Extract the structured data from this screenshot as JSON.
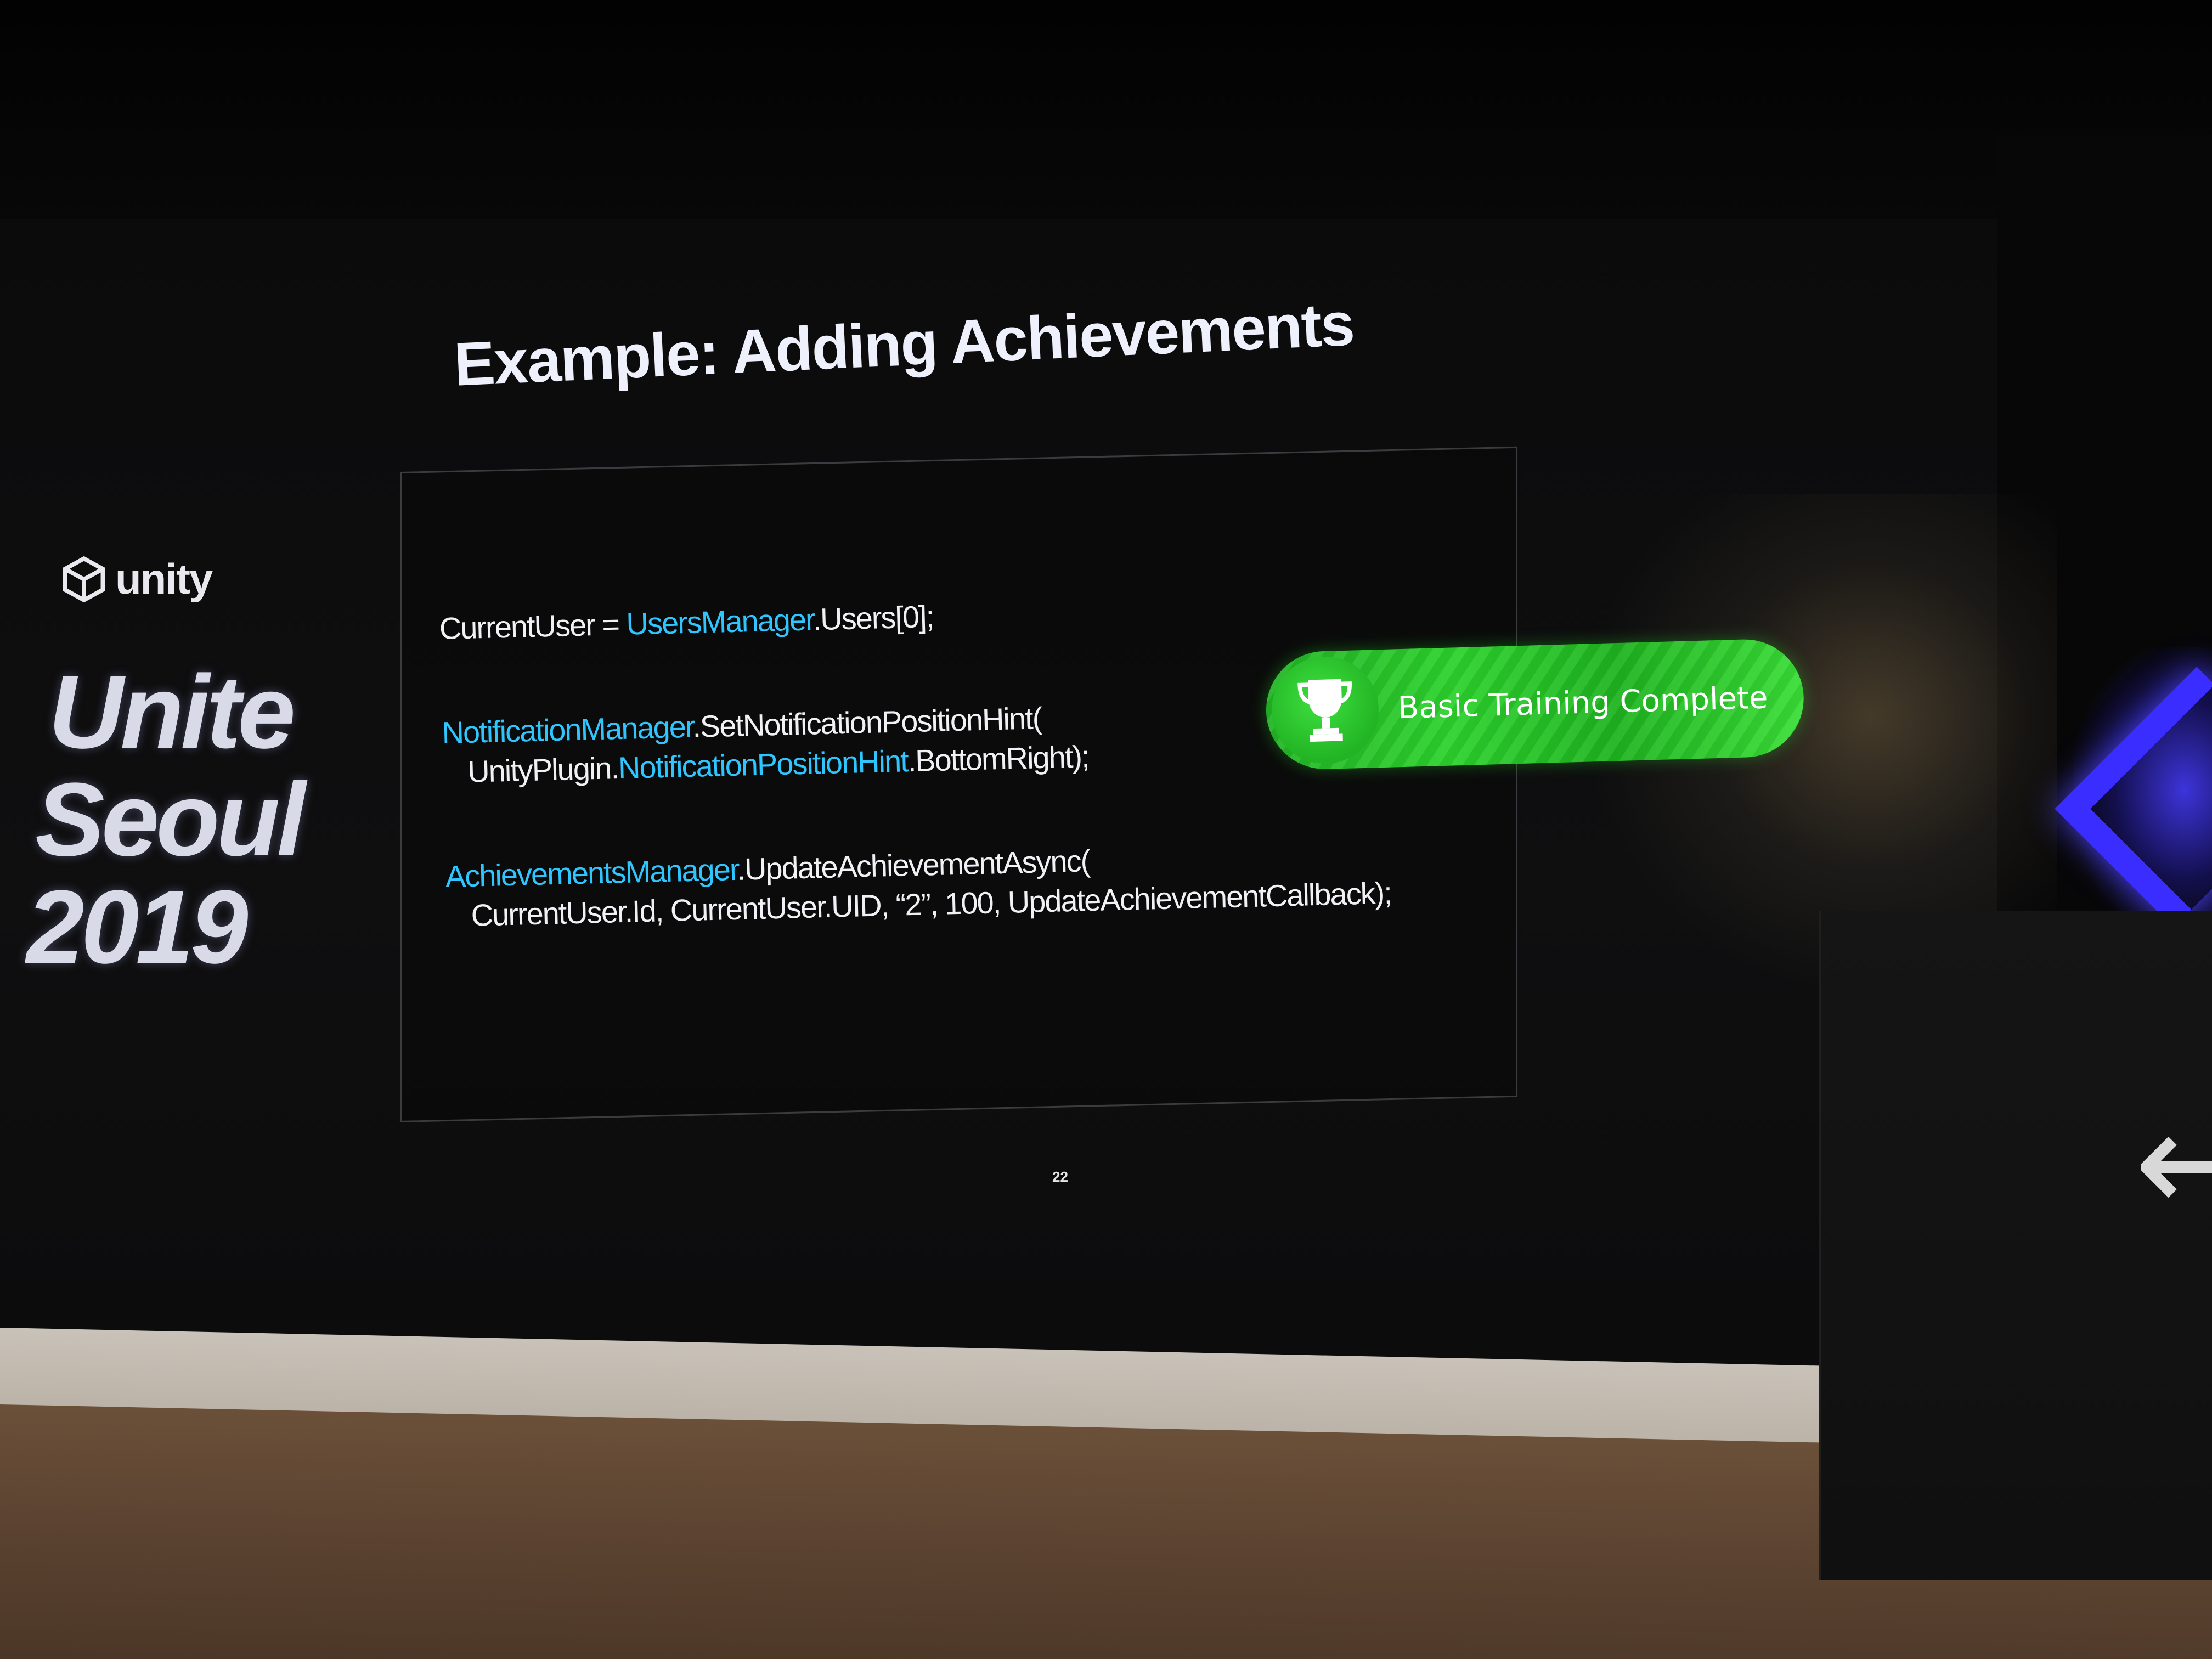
{
  "brand": {
    "logo_icon": "unity-cube-icon",
    "name": "unity"
  },
  "event": {
    "line1": "Unite",
    "line2": "Seoul",
    "line3": "2019"
  },
  "slide": {
    "title": "Example: Adding Achievements",
    "page_number": "22"
  },
  "code": {
    "line1": {
      "prefix": "CurrentUser = ",
      "highlight": "UsersManager",
      "suffix": ".Users[0];"
    },
    "line2": {
      "highlight": "NotificationManager",
      "suffix": ".SetNotificationPositionHint("
    },
    "line3": {
      "prefix": "UnityPlugin.",
      "highlight": "NotificationPositionHint",
      "suffix": ".BottomRight);"
    },
    "line4": {
      "highlight": "AchievementsManager",
      "suffix": ".UpdateAchievementAsync("
    },
    "line5": {
      "text": "CurrentUser.Id, CurrentUser.UID, “2”, 100, UpdateAchievementCallback);"
    }
  },
  "achievement": {
    "icon": "trophy-icon",
    "label": "Basic Training Complete"
  },
  "colors": {
    "code_highlight": "#2fc6ff",
    "achievement_green": "#2cd22d",
    "stage_glow_blue": "#3a2dff"
  },
  "podium": {
    "icon": "arrow-left-icon"
  }
}
